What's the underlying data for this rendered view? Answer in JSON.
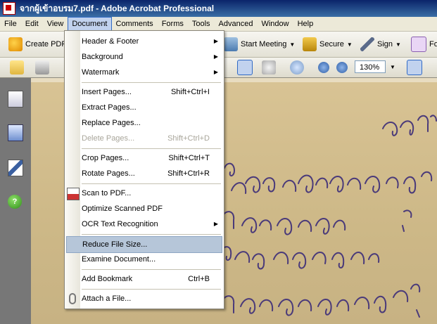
{
  "window": {
    "title": "จากผู้เข้าอบรม7.pdf - Adobe Acrobat Professional"
  },
  "menubar": {
    "items": [
      "File",
      "Edit",
      "View",
      "Document",
      "Comments",
      "Forms",
      "Tools",
      "Advanced",
      "Window",
      "Help"
    ]
  },
  "toolbar": {
    "create_pdf": "Create PDF",
    "start_meeting": "Start Meeting",
    "secure": "Secure",
    "sign": "Sign",
    "forms_partial": "Fo",
    "zoom": "130%"
  },
  "document_menu": {
    "items": [
      {
        "label": "Header & Footer",
        "shortcut": "",
        "submenu": true
      },
      {
        "label": "Background",
        "shortcut": "",
        "submenu": true
      },
      {
        "label": "Watermark",
        "shortcut": "",
        "submenu": true
      },
      {
        "label": "Insert Pages...",
        "shortcut": "Shift+Ctrl+I"
      },
      {
        "label": "Extract Pages...",
        "shortcut": ""
      },
      {
        "label": "Replace Pages...",
        "shortcut": ""
      },
      {
        "label": "Delete Pages...",
        "shortcut": "Shift+Ctrl+D",
        "disabled": true
      },
      {
        "label": "Crop Pages...",
        "shortcut": "Shift+Ctrl+T"
      },
      {
        "label": "Rotate Pages...",
        "shortcut": "Shift+Ctrl+R"
      },
      {
        "label": "Scan to PDF...",
        "shortcut": ""
      },
      {
        "label": "Optimize Scanned PDF",
        "shortcut": ""
      },
      {
        "label": "OCR Text Recognition",
        "shortcut": "",
        "submenu": true
      },
      {
        "label": "Reduce File Size...",
        "shortcut": "",
        "highlighted": true
      },
      {
        "label": "Examine Document...",
        "shortcut": ""
      },
      {
        "label": "Add Bookmark",
        "shortcut": "Ctrl+B"
      },
      {
        "label": "Attach a File...",
        "shortcut": ""
      }
    ]
  },
  "icons": {
    "sidebar": [
      "pages-icon",
      "bookmarks-icon",
      "signatures-icon",
      "help-icon"
    ],
    "help_glyph": "?"
  },
  "glyphs": {
    "submenu_arrow": "▶",
    "dropdown_caret": "▼"
  },
  "colors": {
    "title_bar": "#0a246a",
    "menu_highlight": "#b6c6d9",
    "document_paper": "#d2be8e",
    "ink": "#4a3a7a"
  }
}
